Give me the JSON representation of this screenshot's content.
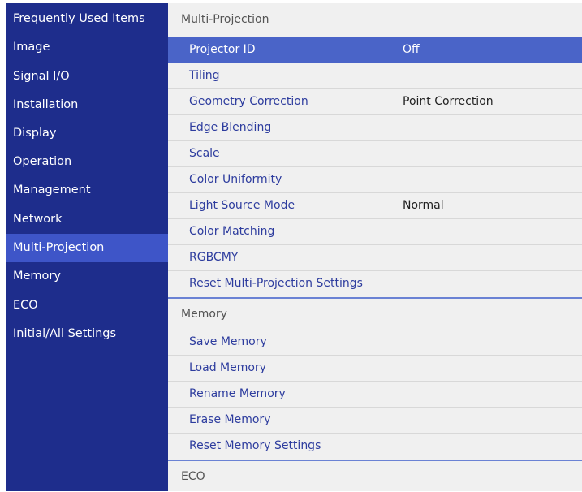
{
  "sidebar": {
    "items": [
      {
        "label": "Frequently Used Items",
        "selected": false
      },
      {
        "label": "Image",
        "selected": false
      },
      {
        "label": "Signal I/O",
        "selected": false
      },
      {
        "label": "Installation",
        "selected": false
      },
      {
        "label": "Display",
        "selected": false
      },
      {
        "label": "Operation",
        "selected": false
      },
      {
        "label": "Management",
        "selected": false
      },
      {
        "label": "Network",
        "selected": false
      },
      {
        "label": "Multi-Projection",
        "selected": true
      },
      {
        "label": "Memory",
        "selected": false
      },
      {
        "label": "ECO",
        "selected": false
      },
      {
        "label": "Initial/All Settings",
        "selected": false
      }
    ]
  },
  "main": {
    "multi_projection": {
      "header": "Multi-Projection",
      "items": [
        {
          "label": "Projector ID",
          "value": "Off",
          "selected": true
        },
        {
          "label": "Tiling",
          "value": ""
        },
        {
          "label": "Geometry Correction",
          "value": "Point Correction"
        },
        {
          "label": "Edge Blending",
          "value": ""
        },
        {
          "label": "Scale",
          "value": ""
        },
        {
          "label": "Color Uniformity",
          "value": ""
        },
        {
          "label": "Light Source Mode",
          "value": "Normal"
        },
        {
          "label": "Color Matching",
          "value": ""
        },
        {
          "label": "RGBCMY",
          "value": ""
        },
        {
          "label": "Reset Multi-Projection Settings",
          "value": ""
        }
      ]
    },
    "memory": {
      "header": "Memory",
      "items": [
        {
          "label": "Save Memory"
        },
        {
          "label": "Load Memory"
        },
        {
          "label": "Rename Memory"
        },
        {
          "label": "Erase Memory"
        },
        {
          "label": "Reset Memory Settings"
        }
      ]
    },
    "eco": {
      "header": "ECO"
    }
  },
  "colors": {
    "sidebar_bg": "#1e2d8c",
    "sidebar_selected": "#3e55c8",
    "row_selected": "#4a64c8",
    "item_text": "#2d3c9e",
    "panel_bg": "#f0f0f0"
  }
}
